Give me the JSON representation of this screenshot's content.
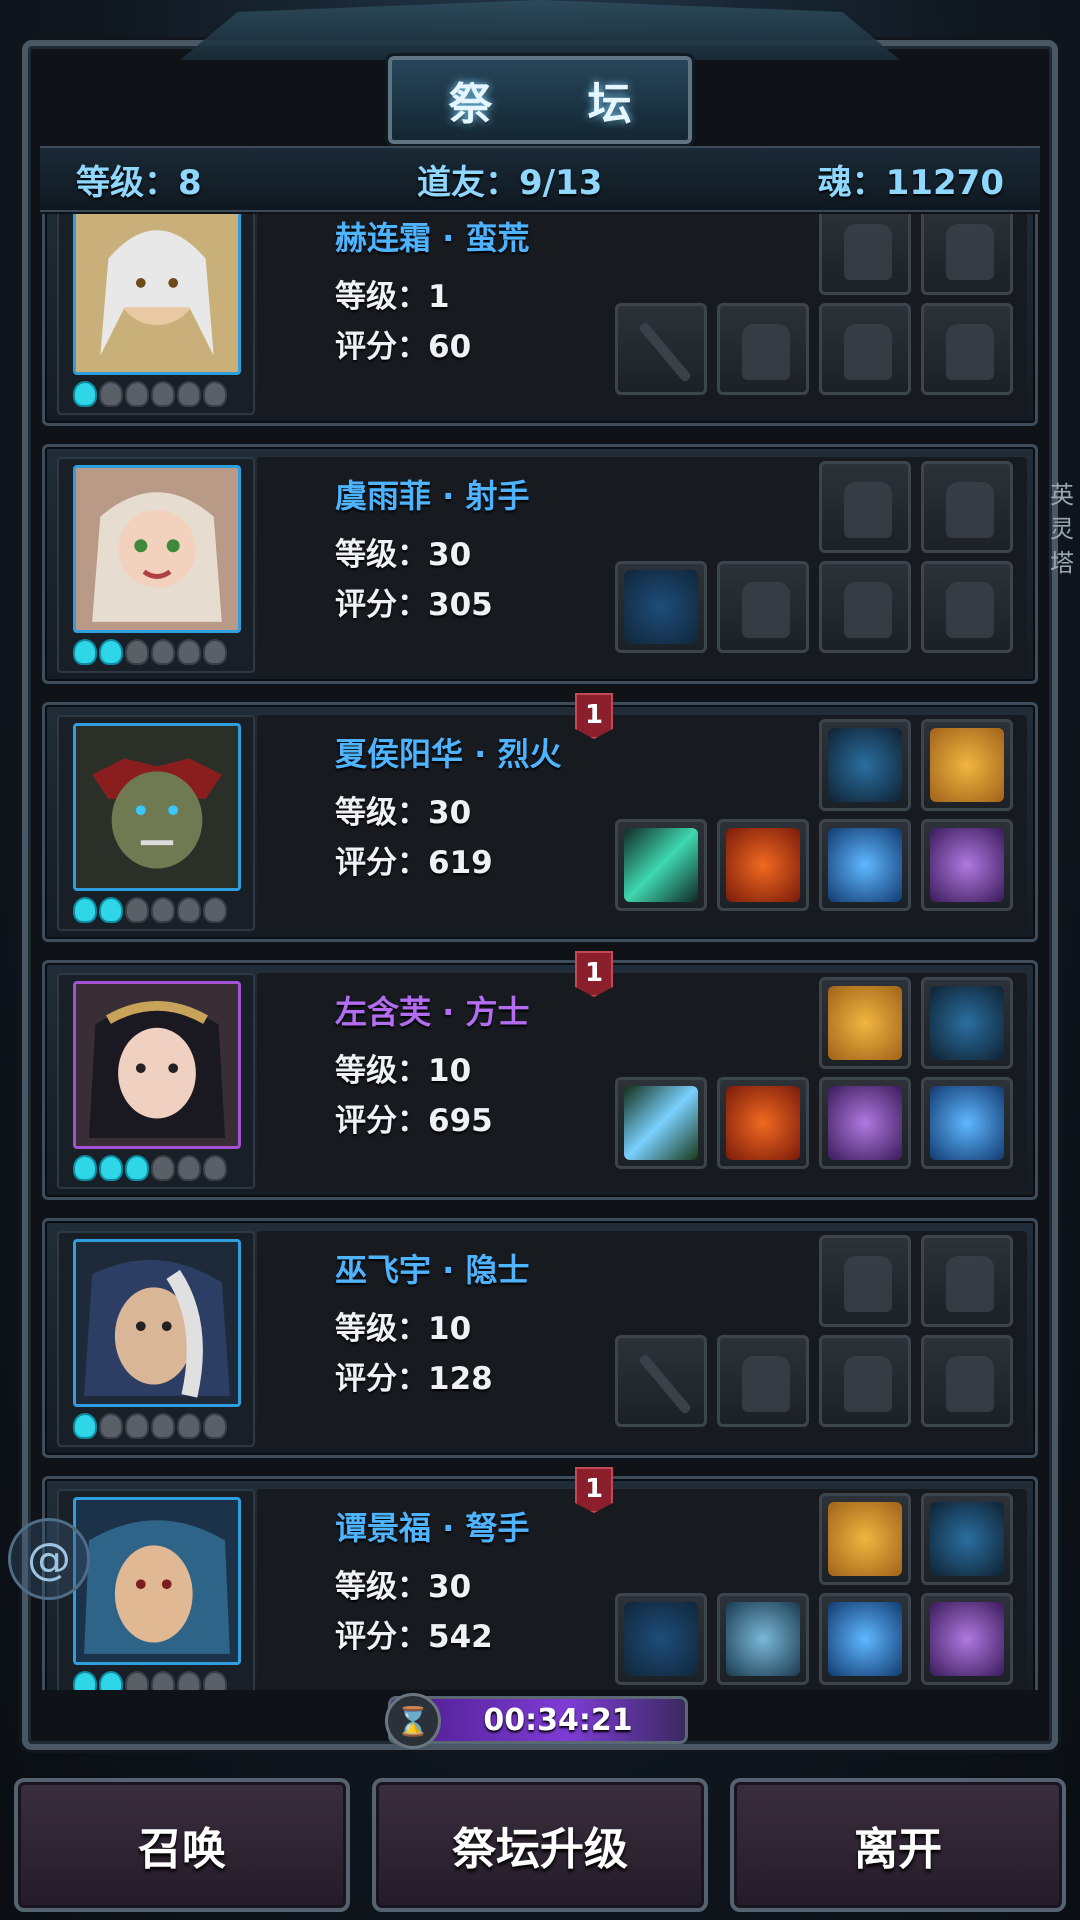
{
  "header": {
    "title": "祭 坛",
    "level": "等级：8",
    "companions": "道友：9/13",
    "soul": "魂：11270"
  },
  "side_tab": "英灵塔",
  "heroes": [
    {
      "name": "赫连霜 · 蛮荒",
      "level": "等级：1",
      "score": "评分：60",
      "stars": 1,
      "badge": ""
    },
    {
      "name": "虞雨菲 · 射手",
      "level": "等级：30",
      "score": "评分：305",
      "stars": 2,
      "badge": ""
    },
    {
      "name": "夏侯阳华 · 烈火",
      "level": "等级：30",
      "score": "评分：619",
      "stars": 2,
      "badge": "1"
    },
    {
      "name": "左含芙 · 方士",
      "level": "等级：10",
      "score": "评分：695",
      "stars": 3,
      "badge": "1"
    },
    {
      "name": "巫飞宇 · 隐士",
      "level": "等级：10",
      "score": "评分：128",
      "stars": 1,
      "badge": ""
    },
    {
      "name": "谭景福 · 弩手",
      "level": "等级：30",
      "score": "评分：542",
      "stars": 2,
      "badge": "1"
    }
  ],
  "timer": "00:34:21",
  "buttons": {
    "summon": "召唤",
    "upgrade": "祭坛升级",
    "leave": "离开"
  },
  "colors": {
    "name_blue": "#4fb4ff",
    "name_purple": "#b36cf2",
    "stat_cyan": "#8fd7ff",
    "star_on": "#2fd6e8"
  }
}
